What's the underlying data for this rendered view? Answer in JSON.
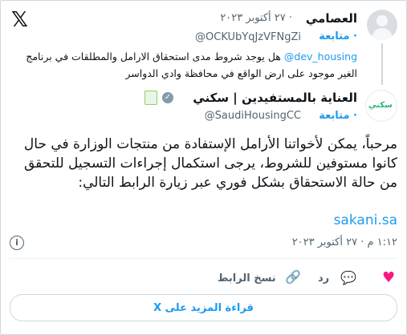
{
  "reply_tweet": {
    "author_name": "العصامي",
    "date": "· ٢٧ أكتوبر ٢٠٢٣",
    "handle": "@OCKUbYqJzVFNgZi",
    "follow_label": "· متابعة",
    "mention": "@dev_housing",
    "text": "هل يوجد شروط مدى استحقاق الارامل والمطلقات في برنامج الغير موجود على ارض الواقع في محافظة وادي الدواسر"
  },
  "main_tweet": {
    "author_name": "العناية بالمستفيدين | سكني",
    "handle": "@SaudiHousingCC",
    "follow_label": "· متابعة",
    "avatar_logo": "سكني",
    "body": "مرحباً، يمكن لأخواتنا الأرامل الإستفادة من منتجات الوزارة في حال كانوا مستوفين للشروط، يرجى استكمال إجراءات التسجيل للتحقق من حالة الاستحقاق بشكل فوري عبر زيارة الرابط التالي:",
    "link": "sakani.sa",
    "timestamp": "١:١٢ م · ٢٧ أكتوبر ٢٠٢٣"
  },
  "actions": {
    "reply_label": "رد",
    "copy_link_label": "نسخ الرابط",
    "read_more_label": "قراءة المزيد على X"
  },
  "colors": {
    "accent": "#1d9bf0",
    "like": "#f91880",
    "text": "#0f1419",
    "muted": "#536471"
  },
  "icons": [
    "x-logo-icon",
    "verified-badge-icon",
    "info-icon",
    "heart-icon",
    "reply-icon",
    "link-icon"
  ]
}
